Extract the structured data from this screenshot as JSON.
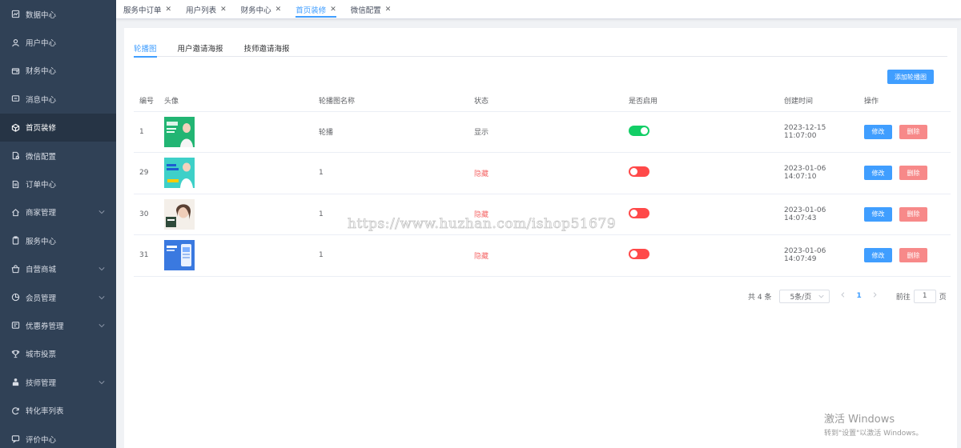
{
  "sidebar": {
    "items": [
      {
        "label": "数据中心",
        "icon": "chart-icon",
        "expandable": false
      },
      {
        "label": "用户中心",
        "icon": "user-icon",
        "expandable": false
      },
      {
        "label": "财务中心",
        "icon": "wallet-icon",
        "expandable": false
      },
      {
        "label": "消息中心",
        "icon": "message-icon",
        "expandable": false
      },
      {
        "label": "首页装修",
        "icon": "cube-icon",
        "expandable": false,
        "active": true
      },
      {
        "label": "微信配置",
        "icon": "document-gear-icon",
        "expandable": false
      },
      {
        "label": "订单中心",
        "icon": "document-icon",
        "expandable": false
      },
      {
        "label": "商家管理",
        "icon": "home-icon",
        "expandable": true
      },
      {
        "label": "服务中心",
        "icon": "clipboard-icon",
        "expandable": false
      },
      {
        "label": "自营商城",
        "icon": "shop-icon",
        "expandable": true
      },
      {
        "label": "会员管理",
        "icon": "pie-icon",
        "expandable": true
      },
      {
        "label": "优惠券管理",
        "icon": "coupon-icon",
        "expandable": true
      },
      {
        "label": "城市投票",
        "icon": "trophy-icon",
        "expandable": false
      },
      {
        "label": "技师管理",
        "icon": "person-icon",
        "expandable": true
      },
      {
        "label": "转化率列表",
        "icon": "refresh-icon",
        "expandable": false
      },
      {
        "label": "评价中心",
        "icon": "comment-icon",
        "expandable": false
      }
    ]
  },
  "tabs": [
    {
      "label": "服务中订单",
      "active": false
    },
    {
      "label": "用户列表",
      "active": false
    },
    {
      "label": "财务中心",
      "active": false
    },
    {
      "label": "首页装修",
      "active": true
    },
    {
      "label": "微信配置",
      "active": false
    }
  ],
  "tab_close_glyph": "✕",
  "inner_tabs": [
    {
      "label": "轮播图",
      "active": true
    },
    {
      "label": "用户邀请海报",
      "active": false
    },
    {
      "label": "技师邀请海报",
      "active": false
    }
  ],
  "add_button": "添加轮播图",
  "table": {
    "headers": [
      "编号",
      "头像",
      "轮播图名称",
      "状态",
      "是否启用",
      "创建时间",
      "操作"
    ],
    "rows": [
      {
        "id": "1",
        "thumb": "green",
        "name": "轮播",
        "status": "显示",
        "enabled": true,
        "created": "2023-12-15 11:07:00"
      },
      {
        "id": "29",
        "thumb": "cyan",
        "name": "1",
        "status": "隐藏",
        "enabled": false,
        "created": "2023-01-06 14:07:10"
      },
      {
        "id": "30",
        "thumb": "white",
        "name": "1",
        "status": "隐藏",
        "enabled": false,
        "created": "2023-01-06 14:07:43"
      },
      {
        "id": "31",
        "thumb": "blue",
        "name": "1",
        "status": "隐藏",
        "enabled": false,
        "created": "2023-01-06 14:07:49"
      }
    ],
    "edit_label": "修改",
    "delete_label": "删除"
  },
  "pagination": {
    "total": "共 4 条",
    "page_size": "5条/页",
    "current_page": "1",
    "goto_label": "前往",
    "goto_value": "1",
    "page_suffix": "页"
  },
  "watermark": "https://www.huzhan.com/ishop51679",
  "windows_activation": {
    "title": "激活 Windows",
    "subtitle": "转到\"设置\"以激活 Windows。"
  },
  "colors": {
    "sidebar_bg": "#304156",
    "accent": "#409eff",
    "switch_on": "#13ce66",
    "switch_off": "#ff4949",
    "danger": "#f78989"
  }
}
